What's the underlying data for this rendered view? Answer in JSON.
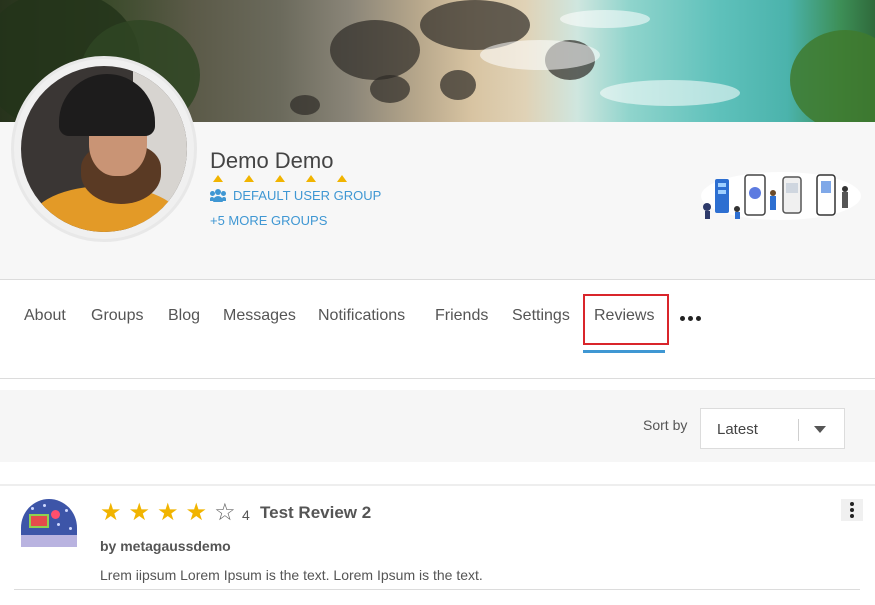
{
  "profile": {
    "name": "Demo Demo",
    "rating_stars": 5,
    "primary_group": "DEFAULT USER GROUP",
    "more_groups": "+5 MORE GROUPS"
  },
  "tabs": [
    {
      "label": "About"
    },
    {
      "label": "Groups"
    },
    {
      "label": "Blog"
    },
    {
      "label": "Messages"
    },
    {
      "label": "Notifications"
    },
    {
      "label": "Friends"
    },
    {
      "label": "Settings"
    },
    {
      "label": "Reviews",
      "active": true
    }
  ],
  "sort": {
    "label": "Sort by",
    "value": "Latest"
  },
  "review": {
    "rating": 4,
    "max_rating": 5,
    "rating_text": "4",
    "title": "Test Review 2",
    "author": "by metagaussdemo",
    "text": "Lrem iipsum Lorem Ipsum is the text. Lorem Ipsum is the text."
  },
  "colors": {
    "accent": "#3f97d3",
    "star": "#f1b400",
    "highlight_border": "#d9252b"
  }
}
